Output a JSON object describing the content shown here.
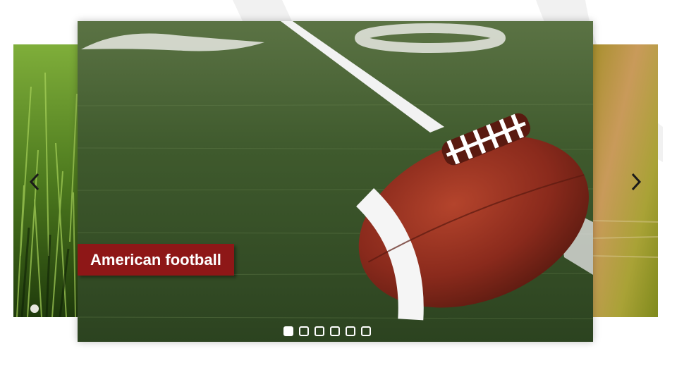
{
  "slider": {
    "caption": "American football",
    "active_index": 0,
    "slides": [
      {
        "image": "american-football-on-field"
      },
      {
        "image": "grass"
      },
      {
        "image": "water-reflection"
      },
      {
        "image": ""
      },
      {
        "image": ""
      },
      {
        "image": ""
      }
    ],
    "prev_icon": "chevron-left-icon",
    "next_icon": "chevron-right-icon"
  },
  "colors": {
    "caption_bg": "#8e1717",
    "turf": "#3e5a2c",
    "ball": "#8a2a1c",
    "yard_line": "#f2f2f2"
  }
}
